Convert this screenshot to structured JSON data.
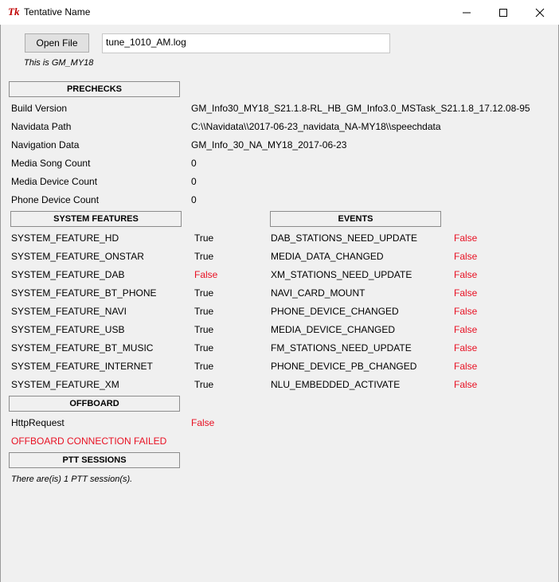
{
  "window": {
    "title": "Tentative Name",
    "icon_name": "tk-feather-icon"
  },
  "toolbar": {
    "open_file_label": "Open File",
    "file_value": "tune_1010_AM.log",
    "version_note": "This is GM_MY18"
  },
  "prechecks": {
    "header": "PRECHECKS",
    "rows": [
      {
        "label": "Build Version",
        "value": "GM_Info30_MY18_S21.1.8-RL_HB_GM_Info3.0_MSTask_S21.1.8_17.12.08-95"
      },
      {
        "label": "Navidata Path",
        "value": "C:\\\\Navidata\\\\2017-06-23_navidata_NA-MY18\\\\speechdata"
      },
      {
        "label": "Navigation Data",
        "value": "GM_Info_30_NA_MY18_2017-06-23"
      },
      {
        "label": "Media Song Count",
        "value": "0"
      },
      {
        "label": "Media Device Count",
        "value": "0"
      },
      {
        "label": "Phone Device Count",
        "value": "0"
      }
    ]
  },
  "system_features": {
    "header": "SYSTEM FEATURES",
    "rows": [
      {
        "label": "SYSTEM_FEATURE_HD",
        "value": "True"
      },
      {
        "label": "SYSTEM_FEATURE_ONSTAR",
        "value": "True"
      },
      {
        "label": "SYSTEM_FEATURE_DAB",
        "value": "False"
      },
      {
        "label": "SYSTEM_FEATURE_BT_PHONE",
        "value": "True"
      },
      {
        "label": "SYSTEM_FEATURE_NAVI",
        "value": "True"
      },
      {
        "label": "SYSTEM_FEATURE_USB",
        "value": "True"
      },
      {
        "label": "SYSTEM_FEATURE_BT_MUSIC",
        "value": "True"
      },
      {
        "label": "SYSTEM_FEATURE_INTERNET",
        "value": "True"
      },
      {
        "label": "SYSTEM_FEATURE_XM",
        "value": "True"
      }
    ]
  },
  "events": {
    "header": "EVENTS",
    "rows": [
      {
        "label": "DAB_STATIONS_NEED_UPDATE",
        "value": "False"
      },
      {
        "label": "MEDIA_DATA_CHANGED",
        "value": "False"
      },
      {
        "label": "XM_STATIONS_NEED_UPDATE",
        "value": "False"
      },
      {
        "label": "NAVI_CARD_MOUNT",
        "value": "False"
      },
      {
        "label": "PHONE_DEVICE_CHANGED",
        "value": "False"
      },
      {
        "label": "MEDIA_DEVICE_CHANGED",
        "value": "False"
      },
      {
        "label": "FM_STATIONS_NEED_UPDATE",
        "value": "False"
      },
      {
        "label": "PHONE_DEVICE_PB_CHANGED",
        "value": "False"
      },
      {
        "label": "NLU_EMBEDDED_ACTIVATE",
        "value": "False"
      }
    ]
  },
  "offboard": {
    "header": "OFFBOARD",
    "http_label": "HttpRequest",
    "http_value": "False",
    "status_text": "OFFBOARD CONNECTION FAILED"
  },
  "ptt": {
    "header": "PTT SESSIONS",
    "summary": "There are(is) 1 PTT session(s)."
  },
  "colors": {
    "false_color": "#e81123",
    "true_color": "#000000"
  }
}
